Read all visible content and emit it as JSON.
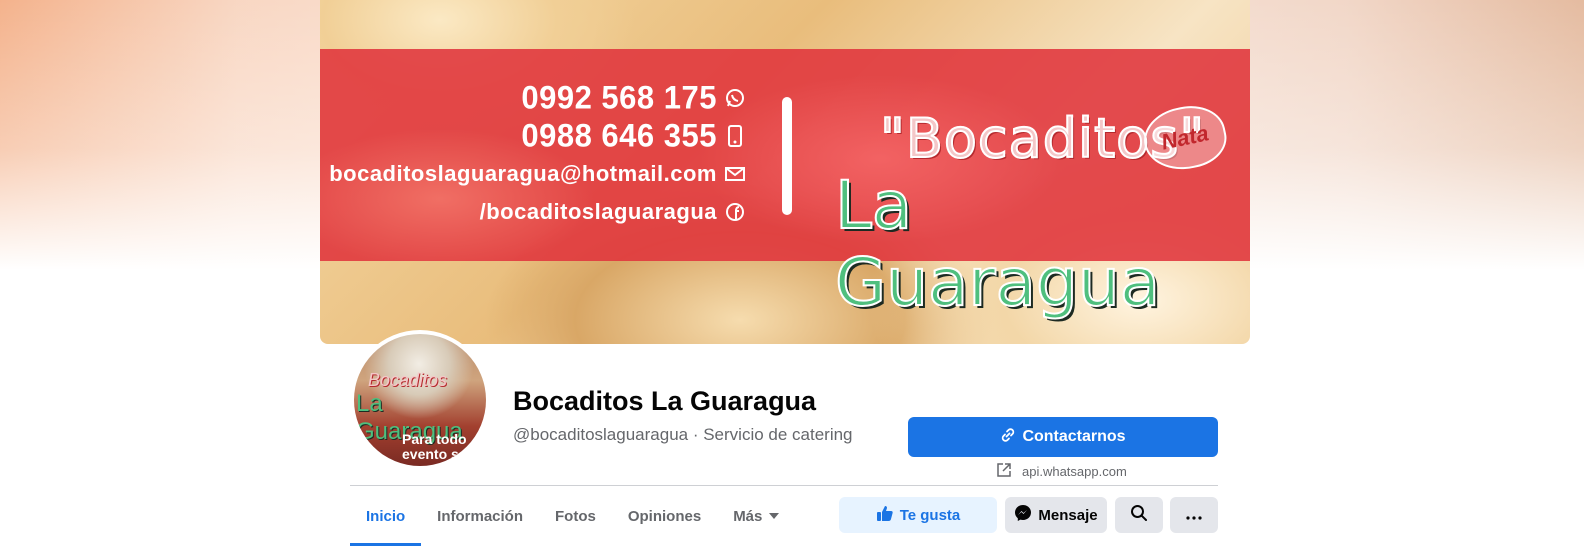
{
  "cover": {
    "phone_1": "0992 568 175",
    "phone_2": "0988 646 355",
    "email": "bocaditoslaguaragua@hotmail.com",
    "facebook": "/bocaditoslaguaragua",
    "brand_line_1": "\"Bocaditos\"",
    "brand_line_2": "La Guaragua",
    "logo_text": "Nata"
  },
  "avatar": {
    "line_1": "Bocaditos",
    "line_2": "La Guaragua",
    "line_3": "Para todo",
    "line_4": "evento se"
  },
  "profile": {
    "name": "Bocaditos La Guaragua",
    "subtitle": "@bocaditoslaguaragua · Servicio de catering"
  },
  "cta": {
    "contact_label": "Contactarnos",
    "link_text": "api.whatsapp.com"
  },
  "tabs": [
    {
      "label": "Inicio"
    },
    {
      "label": "Información"
    },
    {
      "label": "Fotos"
    },
    {
      "label": "Opiniones"
    },
    {
      "label": "Más"
    }
  ],
  "actions": {
    "like_label": "Te gusta",
    "message_label": "Mensaje"
  },
  "colors": {
    "accent": "#1b74e4",
    "cover_band": "#e0343c",
    "brand_green": "#4fbf7e"
  },
  "icons": {
    "whatsapp": "whatsapp-icon",
    "phone": "phone-icon",
    "email": "envelope-icon",
    "facebook": "facebook-icon",
    "link": "link-icon",
    "external": "external-link-icon",
    "like": "thumbs-up-icon",
    "messenger": "messenger-icon",
    "search": "search-icon",
    "more": "more-icon",
    "caret": "caret-down-icon"
  }
}
